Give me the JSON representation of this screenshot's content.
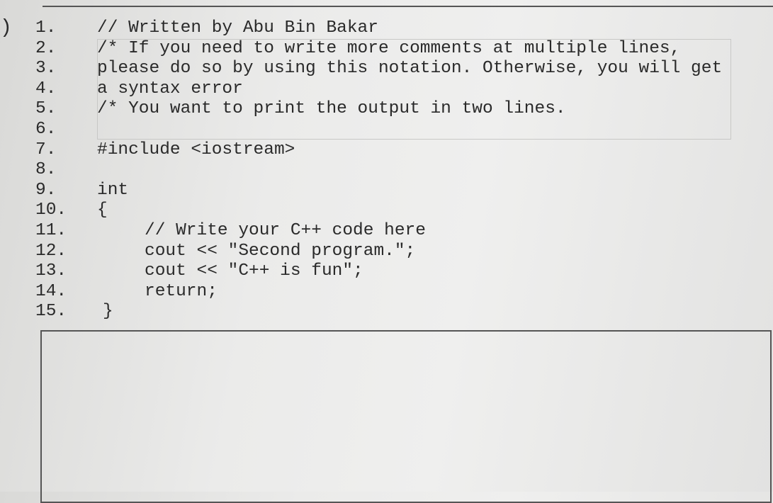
{
  "question_marker": ")",
  "lines": [
    {
      "num": "1.",
      "code": "// Written by Abu Bin Bakar",
      "indent": 0
    },
    {
      "num": "2.",
      "code": "/* If you need to write more comments at multiple lines,",
      "indent": 0
    },
    {
      "num": "3.",
      "code": "please do so by using this notation. Otherwise, you will get",
      "indent": 0
    },
    {
      "num": "4.",
      "code": "a syntax error",
      "indent": 0
    },
    {
      "num": "5.",
      "code": "/* You want to print the output in two lines.",
      "indent": 0
    },
    {
      "num": "6.",
      "code": "",
      "indent": 0
    },
    {
      "num": "7.",
      "code": "#include <iostream>",
      "indent": 0
    },
    {
      "num": "8.",
      "code": "",
      "indent": 0
    },
    {
      "num": "9.",
      "code": "int",
      "indent": 0
    },
    {
      "num": "10.",
      "code": "{",
      "indent": 0
    },
    {
      "num": "11.",
      "code": "// Write your C++ code here",
      "indent": 1
    },
    {
      "num": "12.",
      "code": "cout << \"Second program.\";",
      "indent": 1
    },
    {
      "num": "13.",
      "code": "cout << \"C++ is fun\";",
      "indent": 1
    },
    {
      "num": "14.",
      "code": "return;",
      "indent": 1
    },
    {
      "num": "15.",
      "code": "}",
      "indent": 0
    }
  ]
}
